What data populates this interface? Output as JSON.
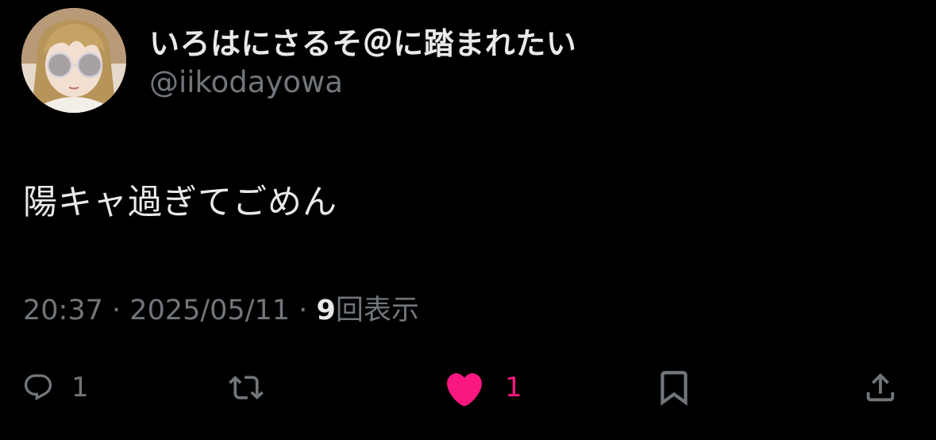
{
  "user": {
    "display_name": "いろはにさるそ＠に踏まれたい",
    "handle": "@iikodayowa"
  },
  "tweet": {
    "text": "陽キャ過ぎてごめん",
    "time": "20:37",
    "separator": "·",
    "date": "2025/05/11",
    "views_count": "9",
    "views_label": "回表示"
  },
  "actions": {
    "reply": {
      "icon": "reply-icon",
      "count": "1"
    },
    "retweet": {
      "icon": "retweet-icon"
    },
    "like": {
      "icon": "heart-icon",
      "count": "1",
      "liked": true
    },
    "bookmark": {
      "icon": "bookmark-icon"
    },
    "share": {
      "icon": "share-icon"
    }
  },
  "colors": {
    "background": "#000000",
    "primary_text": "#e7e9ea",
    "secondary_text": "#71767b",
    "like_accent": "#f91880"
  }
}
